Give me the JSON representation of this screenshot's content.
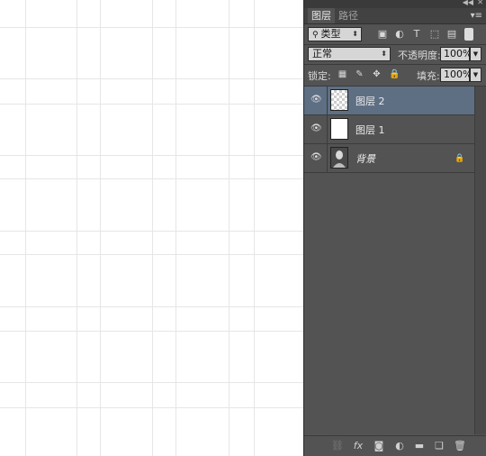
{
  "panel": {
    "tabs": [
      {
        "label": "图层",
        "active": true
      },
      {
        "label": "路径",
        "active": false
      }
    ],
    "filter": {
      "kind_label": "类型"
    },
    "blend_mode": "正常",
    "opacity": {
      "label": "不透明度:",
      "value": "100%"
    },
    "lock": {
      "label": "锁定:"
    },
    "fill": {
      "label": "填充:",
      "value": "100%"
    },
    "layers": [
      {
        "name": "图层 2",
        "thumb": "transparent",
        "selected": true,
        "locked": false,
        "italic": false
      },
      {
        "name": "图层 1",
        "thumb": "white",
        "selected": false,
        "locked": false,
        "italic": false
      },
      {
        "name": "背景",
        "thumb": "photo",
        "selected": false,
        "locked": true,
        "italic": true
      }
    ]
  },
  "icons": {
    "search": "search-icon",
    "eye": "eye-icon",
    "lock": "lock-icon",
    "link": "link-icon",
    "fx": "fx-icon",
    "mask": "mask-icon",
    "adjustment": "adjustment-layer-icon",
    "folder": "folder-icon",
    "new_layer": "new-layer-icon",
    "trash": "trash-icon"
  },
  "colors": {
    "panel_bg": "#535353",
    "selected_layer": "#5e6f84",
    "canvas_bg": "#ffffff"
  }
}
